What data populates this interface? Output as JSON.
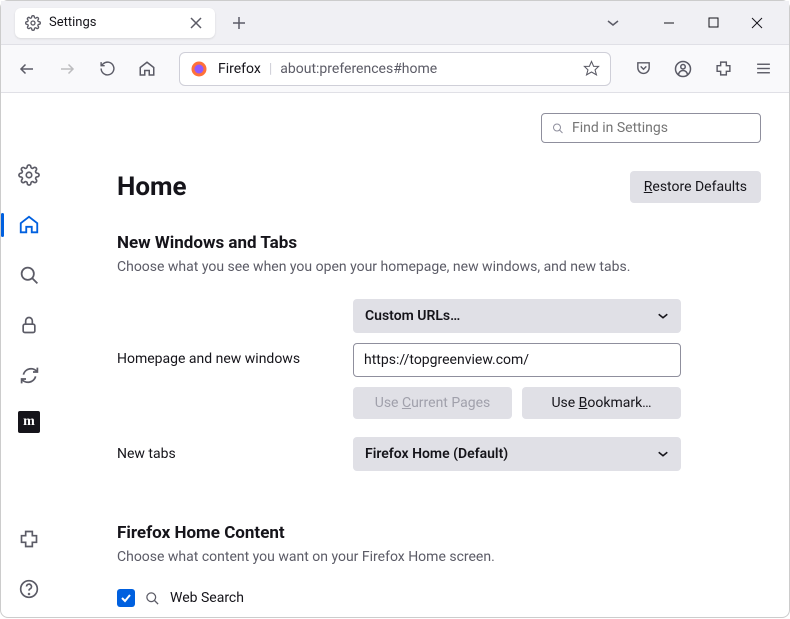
{
  "tab": {
    "title": "Settings"
  },
  "urlbar": {
    "label": "Firefox",
    "url": "about:preferences#home"
  },
  "search": {
    "placeholder": "Find in Settings"
  },
  "header": {
    "title": "Home",
    "restore": "Restore Defaults"
  },
  "section1": {
    "title": "New Windows and Tabs",
    "desc": "Choose what you see when you open your homepage, new windows, and new tabs.",
    "homepage_label": "Homepage and new windows",
    "homepage_dropdown": "Custom URLs…",
    "homepage_value": "https://topgreenview.com/",
    "use_current": "Use Current Pages",
    "use_bookmark": "Use Bookmark…",
    "newtabs_label": "New tabs",
    "newtabs_dropdown": "Firefox Home (Default)"
  },
  "section2": {
    "title": "Firefox Home Content",
    "desc": "Choose what content you want on your Firefox Home screen.",
    "websearch": "Web Search"
  }
}
